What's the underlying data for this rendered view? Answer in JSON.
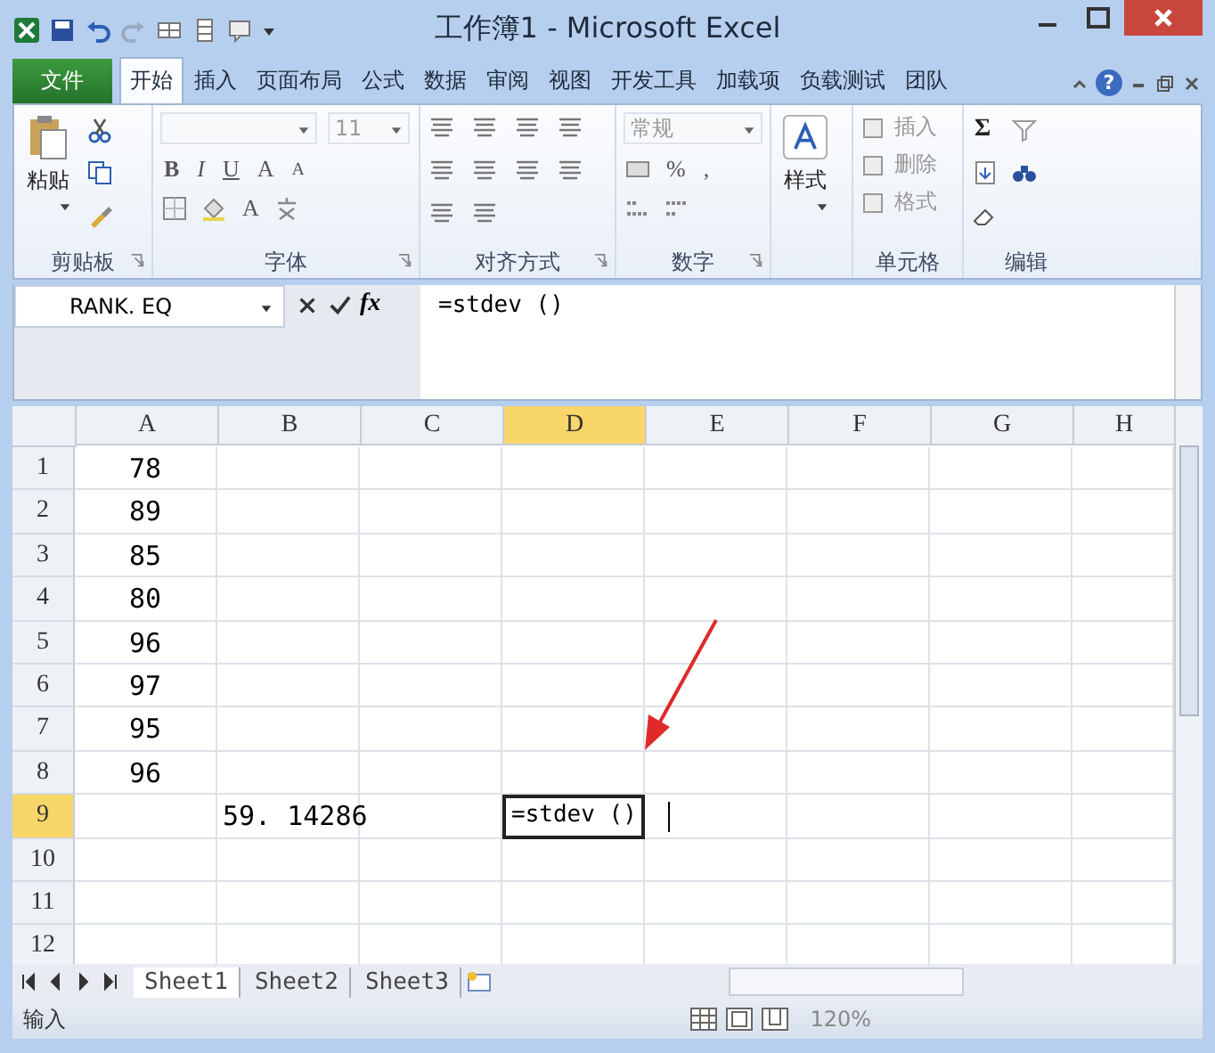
{
  "window": {
    "title": "工作簿1 - Microsoft Excel"
  },
  "tabs": [
    {
      "label": "文件",
      "kind": "file",
      "selected": false
    },
    {
      "label": "开始",
      "kind": "tab",
      "selected": true
    },
    {
      "label": "插入",
      "kind": "tab",
      "selected": false
    },
    {
      "label": "页面布局",
      "kind": "tab",
      "selected": false
    },
    {
      "label": "公式",
      "kind": "tab",
      "selected": false
    },
    {
      "label": "数据",
      "kind": "tab",
      "selected": false
    },
    {
      "label": "审阅",
      "kind": "tab",
      "selected": false
    },
    {
      "label": "视图",
      "kind": "tab",
      "selected": false
    },
    {
      "label": "开发工具",
      "kind": "tab",
      "selected": false
    },
    {
      "label": "加载项",
      "kind": "tab",
      "selected": false
    },
    {
      "label": "负载测试",
      "kind": "tab",
      "selected": false
    },
    {
      "label": "团队",
      "kind": "tab",
      "selected": false
    }
  ],
  "help": "?",
  "ribbon": {
    "groups": [
      {
        "label": "剪贴板",
        "launcher": true
      },
      {
        "label": "字体",
        "launcher": true
      },
      {
        "label": "对齐方式",
        "launcher": true
      },
      {
        "label": "数字",
        "launcher": true
      },
      {
        "launcher": false
      },
      {
        "label": "单元格",
        "launcher": false
      },
      {
        "label": "编辑",
        "launcher": false
      }
    ],
    "paste": "粘贴",
    "font_size": "11",
    "bold": "B",
    "italic": "I",
    "underline": "U",
    "grow_font": "A",
    "shrink_font": "A",
    "font_color": "A",
    "number_format": "常规",
    "percent": "%",
    "comma": ",",
    "styles": "样式",
    "cell_buttons": [
      "插入",
      "删除",
      "格式"
    ],
    "autosum": "Σ"
  },
  "formula_bar": {
    "name_box": "RANK. EQ",
    "function_label": "fx",
    "formula": "=stdev ()"
  },
  "columns": [
    {
      "label": "A",
      "selected": false
    },
    {
      "label": "B",
      "selected": false
    },
    {
      "label": "C",
      "selected": false
    },
    {
      "label": "D",
      "selected": true
    },
    {
      "label": "E",
      "selected": false
    },
    {
      "label": "F",
      "selected": false
    },
    {
      "label": "G",
      "selected": false
    },
    {
      "label": "H",
      "selected": false
    }
  ],
  "rows": [
    {
      "label": "1",
      "selected": false,
      "cells": [
        "78",
        "",
        "",
        "",
        "",
        "",
        "",
        ""
      ]
    },
    {
      "label": "2",
      "selected": false,
      "cells": [
        "89",
        "",
        "",
        "",
        "",
        "",
        "",
        ""
      ]
    },
    {
      "label": "3",
      "selected": false,
      "cells": [
        "85",
        "",
        "",
        "",
        "",
        "",
        "",
        ""
      ]
    },
    {
      "label": "4",
      "selected": false,
      "cells": [
        "80",
        "",
        "",
        "",
        "",
        "",
        "",
        ""
      ]
    },
    {
      "label": "5",
      "selected": false,
      "cells": [
        "96",
        "",
        "",
        "",
        "",
        "",
        "",
        ""
      ]
    },
    {
      "label": "6",
      "selected": false,
      "cells": [
        "97",
        "",
        "",
        "",
        "",
        "",
        "",
        ""
      ]
    },
    {
      "label": "7",
      "selected": false,
      "cells": [
        "95",
        "",
        "",
        "",
        "",
        "",
        "",
        ""
      ]
    },
    {
      "label": "8",
      "selected": false,
      "cells": [
        "96",
        "",
        "",
        "",
        "",
        "",
        "",
        ""
      ]
    },
    {
      "label": "9",
      "selected": true,
      "cells": [
        "",
        "59. 14286",
        "",
        "=stdev ()",
        "",
        "",
        "",
        ""
      ]
    },
    {
      "label": "10",
      "selected": false,
      "cells": [
        "",
        "",
        "",
        "",
        "",
        "",
        "",
        ""
      ]
    },
    {
      "label": "11",
      "selected": false,
      "cells": [
        "",
        "",
        "",
        "",
        "",
        "",
        "",
        ""
      ]
    },
    {
      "label": "12",
      "selected": false,
      "cells": [
        "",
        "",
        "",
        "",
        "",
        "",
        "",
        ""
      ]
    }
  ],
  "sheets": [
    {
      "label": "Sheet1",
      "selected": true
    },
    {
      "label": "Sheet2",
      "selected": false
    },
    {
      "label": "Sheet3",
      "selected": false
    }
  ],
  "status_bar": {
    "mode": "输入",
    "zoom": "120%"
  }
}
